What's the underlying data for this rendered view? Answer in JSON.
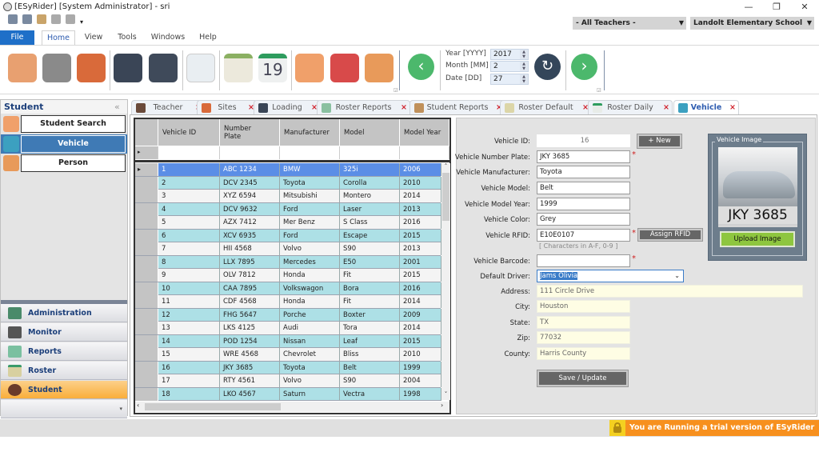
{
  "window": {
    "title": "[ESyRider] [System Administrator] - sri",
    "min": "—",
    "max": "❐",
    "close": "✕"
  },
  "header": {
    "teacher_select": "- All Teachers -",
    "school_select": "Landolt Elementary School"
  },
  "ribbon": {
    "tabs": [
      "File",
      "Home",
      "View",
      "Tools",
      "Windows",
      "Help"
    ],
    "icons": [
      "students-icon",
      "teachers-icon",
      "school-icon",
      "monitor-icon",
      "touch-screen-icon",
      "reports-icon",
      "calendar-icon",
      "calendar-19-icon",
      "people-icon",
      "vehicles-icon",
      "persons-icon"
    ],
    "year_label": "Year [YYYY]",
    "year": "2017",
    "month_label": "Month [MM]",
    "month": "2",
    "date_label": "Date [DD]",
    "date": "27"
  },
  "left_panel": {
    "title": "Student",
    "items": [
      "Student Search",
      "Vehicle",
      "Person"
    ],
    "nav": [
      "Administration",
      "Monitor",
      "Reports",
      "Roster",
      "Student"
    ]
  },
  "doc_tabs": [
    "Teacher",
    "Sites",
    "Loading",
    "Roster Reports",
    "Student Reports",
    "Roster Default",
    "Roster Daily",
    "Vehicle"
  ],
  "grid": {
    "columns": [
      "Vehicle ID",
      "Number Plate",
      "Manufacturer",
      "Model",
      "Model Year"
    ],
    "rows": [
      [
        "1",
        "ABC 1234",
        "BMW",
        "325i",
        "2006"
      ],
      [
        "2",
        "DCV 2345",
        "Toyota",
        "Corolla",
        "2010"
      ],
      [
        "3",
        "XYZ 6594",
        "Mitsubishi",
        "Montero",
        "2014"
      ],
      [
        "4",
        "DCV 9632",
        "Ford",
        "Laser",
        "2013"
      ],
      [
        "5",
        "AZX 7412",
        "Mer Benz",
        "S Class",
        "2016"
      ],
      [
        "6",
        "XCV 6935",
        "Ford",
        "Escape",
        "2015"
      ],
      [
        "7",
        "HII 4568",
        "Volvo",
        "S90",
        "2013"
      ],
      [
        "8",
        "LLX 7895",
        "Mercedes",
        "E50",
        "2001"
      ],
      [
        "9",
        "OLV 7812",
        "Honda",
        "Fit",
        "2015"
      ],
      [
        "10",
        "CAA 7895",
        "Volkswagon",
        "Bora",
        "2016"
      ],
      [
        "11",
        "CDF 4568",
        "Honda",
        "Fit",
        "2014"
      ],
      [
        "12",
        "FHG 5647",
        "Porche",
        "Boxter",
        "2009"
      ],
      [
        "13",
        "LKS 4125",
        "Audi",
        "Tora",
        "2014"
      ],
      [
        "14",
        "POD 1254",
        "Nissan",
        "Leaf",
        "2015"
      ],
      [
        "15",
        "WRE 4568",
        "Chevrolet",
        "Bliss",
        "2010"
      ],
      [
        "16",
        "JKY 3685",
        "Toyota",
        "Belt",
        "1999"
      ],
      [
        "17",
        "RTY 4561",
        "Volvo",
        "S90",
        "2004"
      ],
      [
        "18",
        "LKO 4567",
        "Saturn",
        "Vectra",
        "1998"
      ]
    ]
  },
  "form": {
    "vehicle_id_label": "Vehicle ID:",
    "vehicle_id": "16",
    "plate_label": "Vehicle Number Plate:",
    "plate": "JKY 3685",
    "manufacturer_label": "Vehicle Manufacturer:",
    "manufacturer": "Toyota",
    "model_label": "Vehicle Model:",
    "model": "Belt",
    "year_label": "Vehicle Model Year:",
    "year": "1999",
    "color_label": "Vehicle Color:",
    "color": "Grey",
    "rfid_label": "Vehicle RFID:",
    "rfid": "E10E0107",
    "rfid_hint": "[ Characters in A-F, 0-9 ]",
    "barcode_label": "Vehicle Barcode:",
    "barcode": "",
    "driver_label": "Default Driver:",
    "driver": "Jams Olivia",
    "address_label": "Address:",
    "address": "111 Circle Drive",
    "city_label": "City:",
    "city": "Houston",
    "state_label": "State:",
    "state": "TX",
    "zip_label": "Zip:",
    "zip": "77032",
    "county_label": "County:",
    "county": "Harris County",
    "required": "*",
    "new_button": "+ New",
    "assign_rfid_button": "Assign RFID",
    "save_button": "Save / Update",
    "image_group": "Vehicle Image",
    "image_plate": "JKY 3685",
    "upload_button": "Upload Image"
  },
  "status": {
    "trial": "You are Running a trial version of ESyRider 1.0.0.7"
  },
  "colors": {
    "accent": "#2f6fb5",
    "selected_row": "#5b8ee6",
    "alt_row": "#ade0e6",
    "nav_active": "#fbb040",
    "upload": "#8ec63f",
    "trial": "#f7901e"
  }
}
